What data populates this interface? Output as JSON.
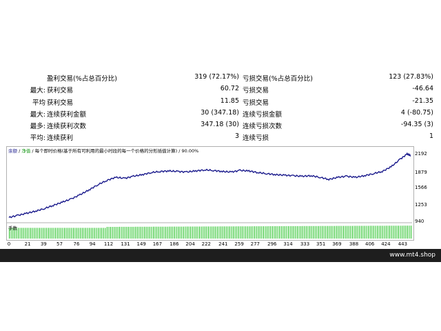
{
  "stats": [
    {
      "prefix": "",
      "label": "盈利交易(%占总百分比)",
      "value": "319 (72.17%)",
      "label2": "亏损交易(%占总百分比)",
      "value2": "123 (27.83%)"
    },
    {
      "prefix": "最大:",
      "label": "获利交易",
      "value": "60.72",
      "label2": "亏损交易",
      "value2": "-46.64"
    },
    {
      "prefix": "平均",
      "label": "获利交易",
      "value": "11.85",
      "label2": "亏损交易",
      "value2": "-21.35"
    },
    {
      "prefix": "最大:",
      "label": "连续获利金额",
      "value": "30 (347.18)",
      "label2": "连续亏损金额",
      "value2": "4 (-80.75)"
    },
    {
      "prefix": "最多:",
      "label": "连续获利次数",
      "value": "347.18 (30)",
      "label2": "连续亏损次数",
      "value2": "-94.35 (3)"
    },
    {
      "prefix": "平均:",
      "label": "连续获利",
      "value": "3",
      "label2": "连续亏损",
      "value2": "1"
    }
  ],
  "chart": {
    "legend_balance": "余额",
    "legend_sep": " / ",
    "legend_equity": "净值",
    "legend_rest": " / 每个即时价格(基于所有可利用的最小时段的每一个价格的分形插值计算) / 90.00%",
    "volume_label": "手数",
    "colors": {
      "line": "#1a1a8c",
      "volume": "#2ec42e"
    }
  },
  "chart_data": {
    "type": "line",
    "title": "",
    "xlabel": "",
    "ylabel": "",
    "y_ticks": [
      "2192",
      "1879",
      "1566",
      "1253",
      "940"
    ],
    "x_ticks": [
      "0",
      "21",
      "39",
      "57",
      "76",
      "94",
      "112",
      "131",
      "149",
      "167",
      "186",
      "204",
      "222",
      "241",
      "259",
      "277",
      "296",
      "314",
      "333",
      "351",
      "369",
      "388",
      "406",
      "424",
      "443"
    ],
    "ylim": [
      940,
      2192
    ],
    "xlim": [
      0,
      452
    ],
    "series": [
      {
        "x": [
          0,
          10,
          20,
          30,
          40,
          50,
          60,
          70,
          80,
          90,
          100,
          110,
          120,
          130,
          140,
          150,
          160,
          170,
          180,
          190,
          200,
          210,
          220,
          230,
          240,
          250,
          260,
          270,
          280,
          290,
          300,
          310,
          320,
          330,
          340,
          350,
          360,
          370,
          380,
          390,
          400,
          410,
          420,
          430,
          440,
          448,
          452
        ],
        "values": [
          1000,
          1040,
          1080,
          1120,
          1170,
          1230,
          1290,
          1350,
          1430,
          1520,
          1620,
          1700,
          1760,
          1740,
          1780,
          1810,
          1850,
          1870,
          1880,
          1870,
          1860,
          1880,
          1900,
          1890,
          1870,
          1860,
          1890,
          1880,
          1850,
          1830,
          1810,
          1800,
          1790,
          1780,
          1790,
          1760,
          1720,
          1760,
          1780,
          1760,
          1790,
          1830,
          1870,
          1960,
          2100,
          2200,
          2170
        ]
      }
    ],
    "volume": {
      "ylim": [
        0,
        1
      ],
      "values_note": "lots bars near constant",
      "level": 0.9
    }
  },
  "watermark": "www.mt4.shop"
}
